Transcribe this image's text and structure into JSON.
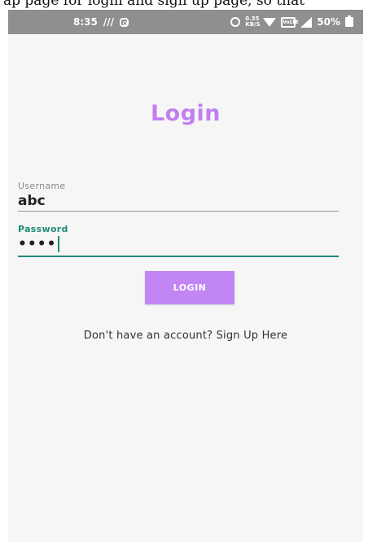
{
  "caption": {
    "text": "ap page for login and sign up page, so that"
  },
  "status_bar": {
    "time": "8:35",
    "notif_glyph": "///",
    "speed": "0.35 KB/S",
    "battery": "50%",
    "volte": "VoLTE",
    "icons": [
      "instagram-icon",
      "alarm-icon",
      "wifi-icon",
      "volte-icon",
      "signal-icon",
      "battery-icon"
    ]
  },
  "login": {
    "title": "Login",
    "username_label": "Username",
    "username_value": "abc",
    "password_label": "Password",
    "password_value": "••••",
    "button_label": "LOGIN",
    "signup_text": "Don't have an account? Sign Up Here"
  },
  "colors": {
    "accent": "#c27ff0",
    "focus": "#1e8a78",
    "status_bar": "#8f8f8f",
    "background": "#f6f6f6"
  }
}
